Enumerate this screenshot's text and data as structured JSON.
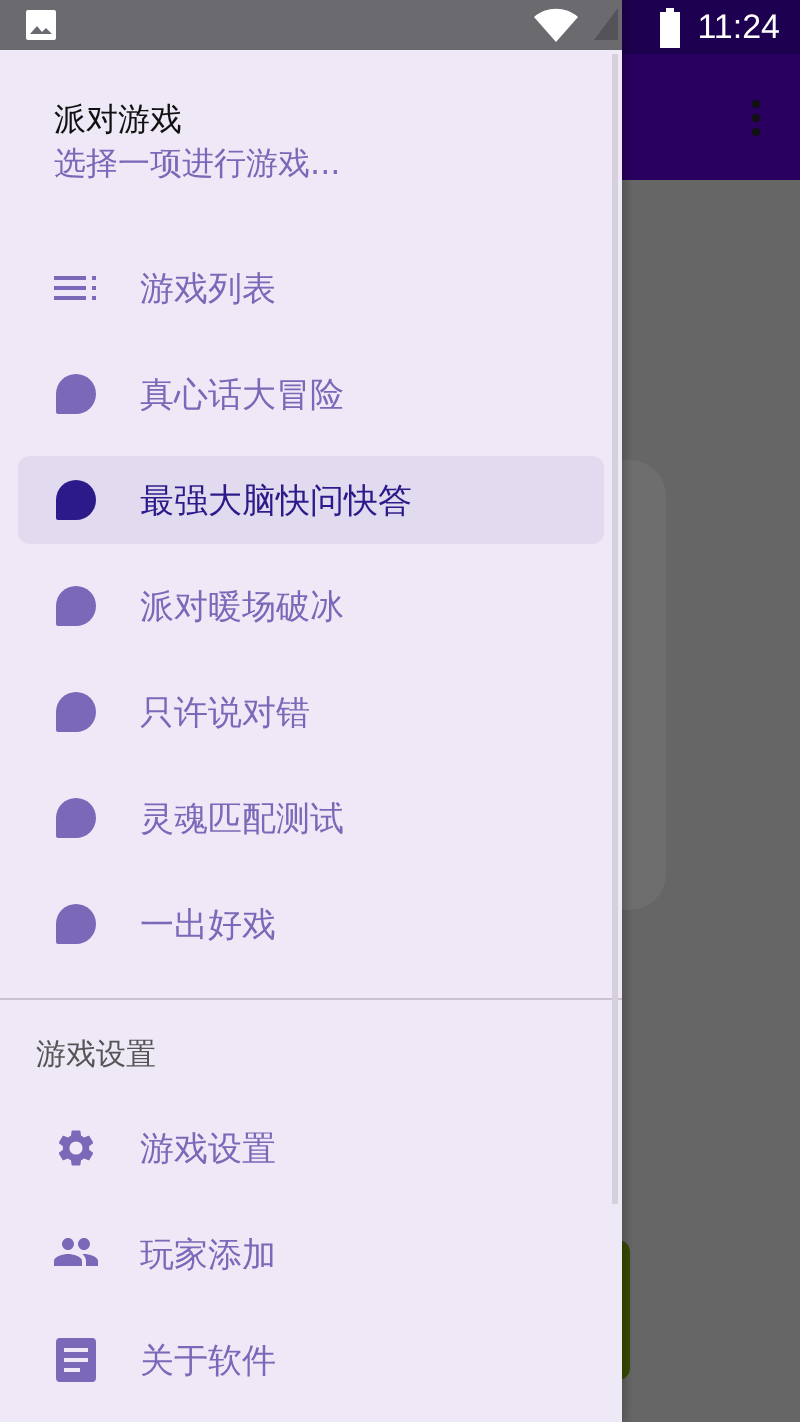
{
  "status_bar": {
    "time": "11:24"
  },
  "drawer": {
    "title": "派对游戏",
    "subtitle": "选择一项进行游戏...",
    "items": [
      {
        "label": "游戏列表",
        "kind": "list",
        "selected": false
      },
      {
        "label": "真心话大冒险",
        "kind": "game",
        "selected": false
      },
      {
        "label": "最强大脑快问快答",
        "kind": "game",
        "selected": true
      },
      {
        "label": "派对暖场破冰",
        "kind": "game",
        "selected": false
      },
      {
        "label": "只许说对错",
        "kind": "game",
        "selected": false
      },
      {
        "label": "灵魂匹配测试",
        "kind": "game",
        "selected": false
      },
      {
        "label": "一出好戏",
        "kind": "game",
        "selected": false
      }
    ],
    "section": "游戏设置",
    "settings": [
      {
        "label": "游戏设置",
        "kind": "gear"
      },
      {
        "label": "玩家添加",
        "kind": "people"
      },
      {
        "label": "关于软件",
        "kind": "document"
      }
    ]
  }
}
